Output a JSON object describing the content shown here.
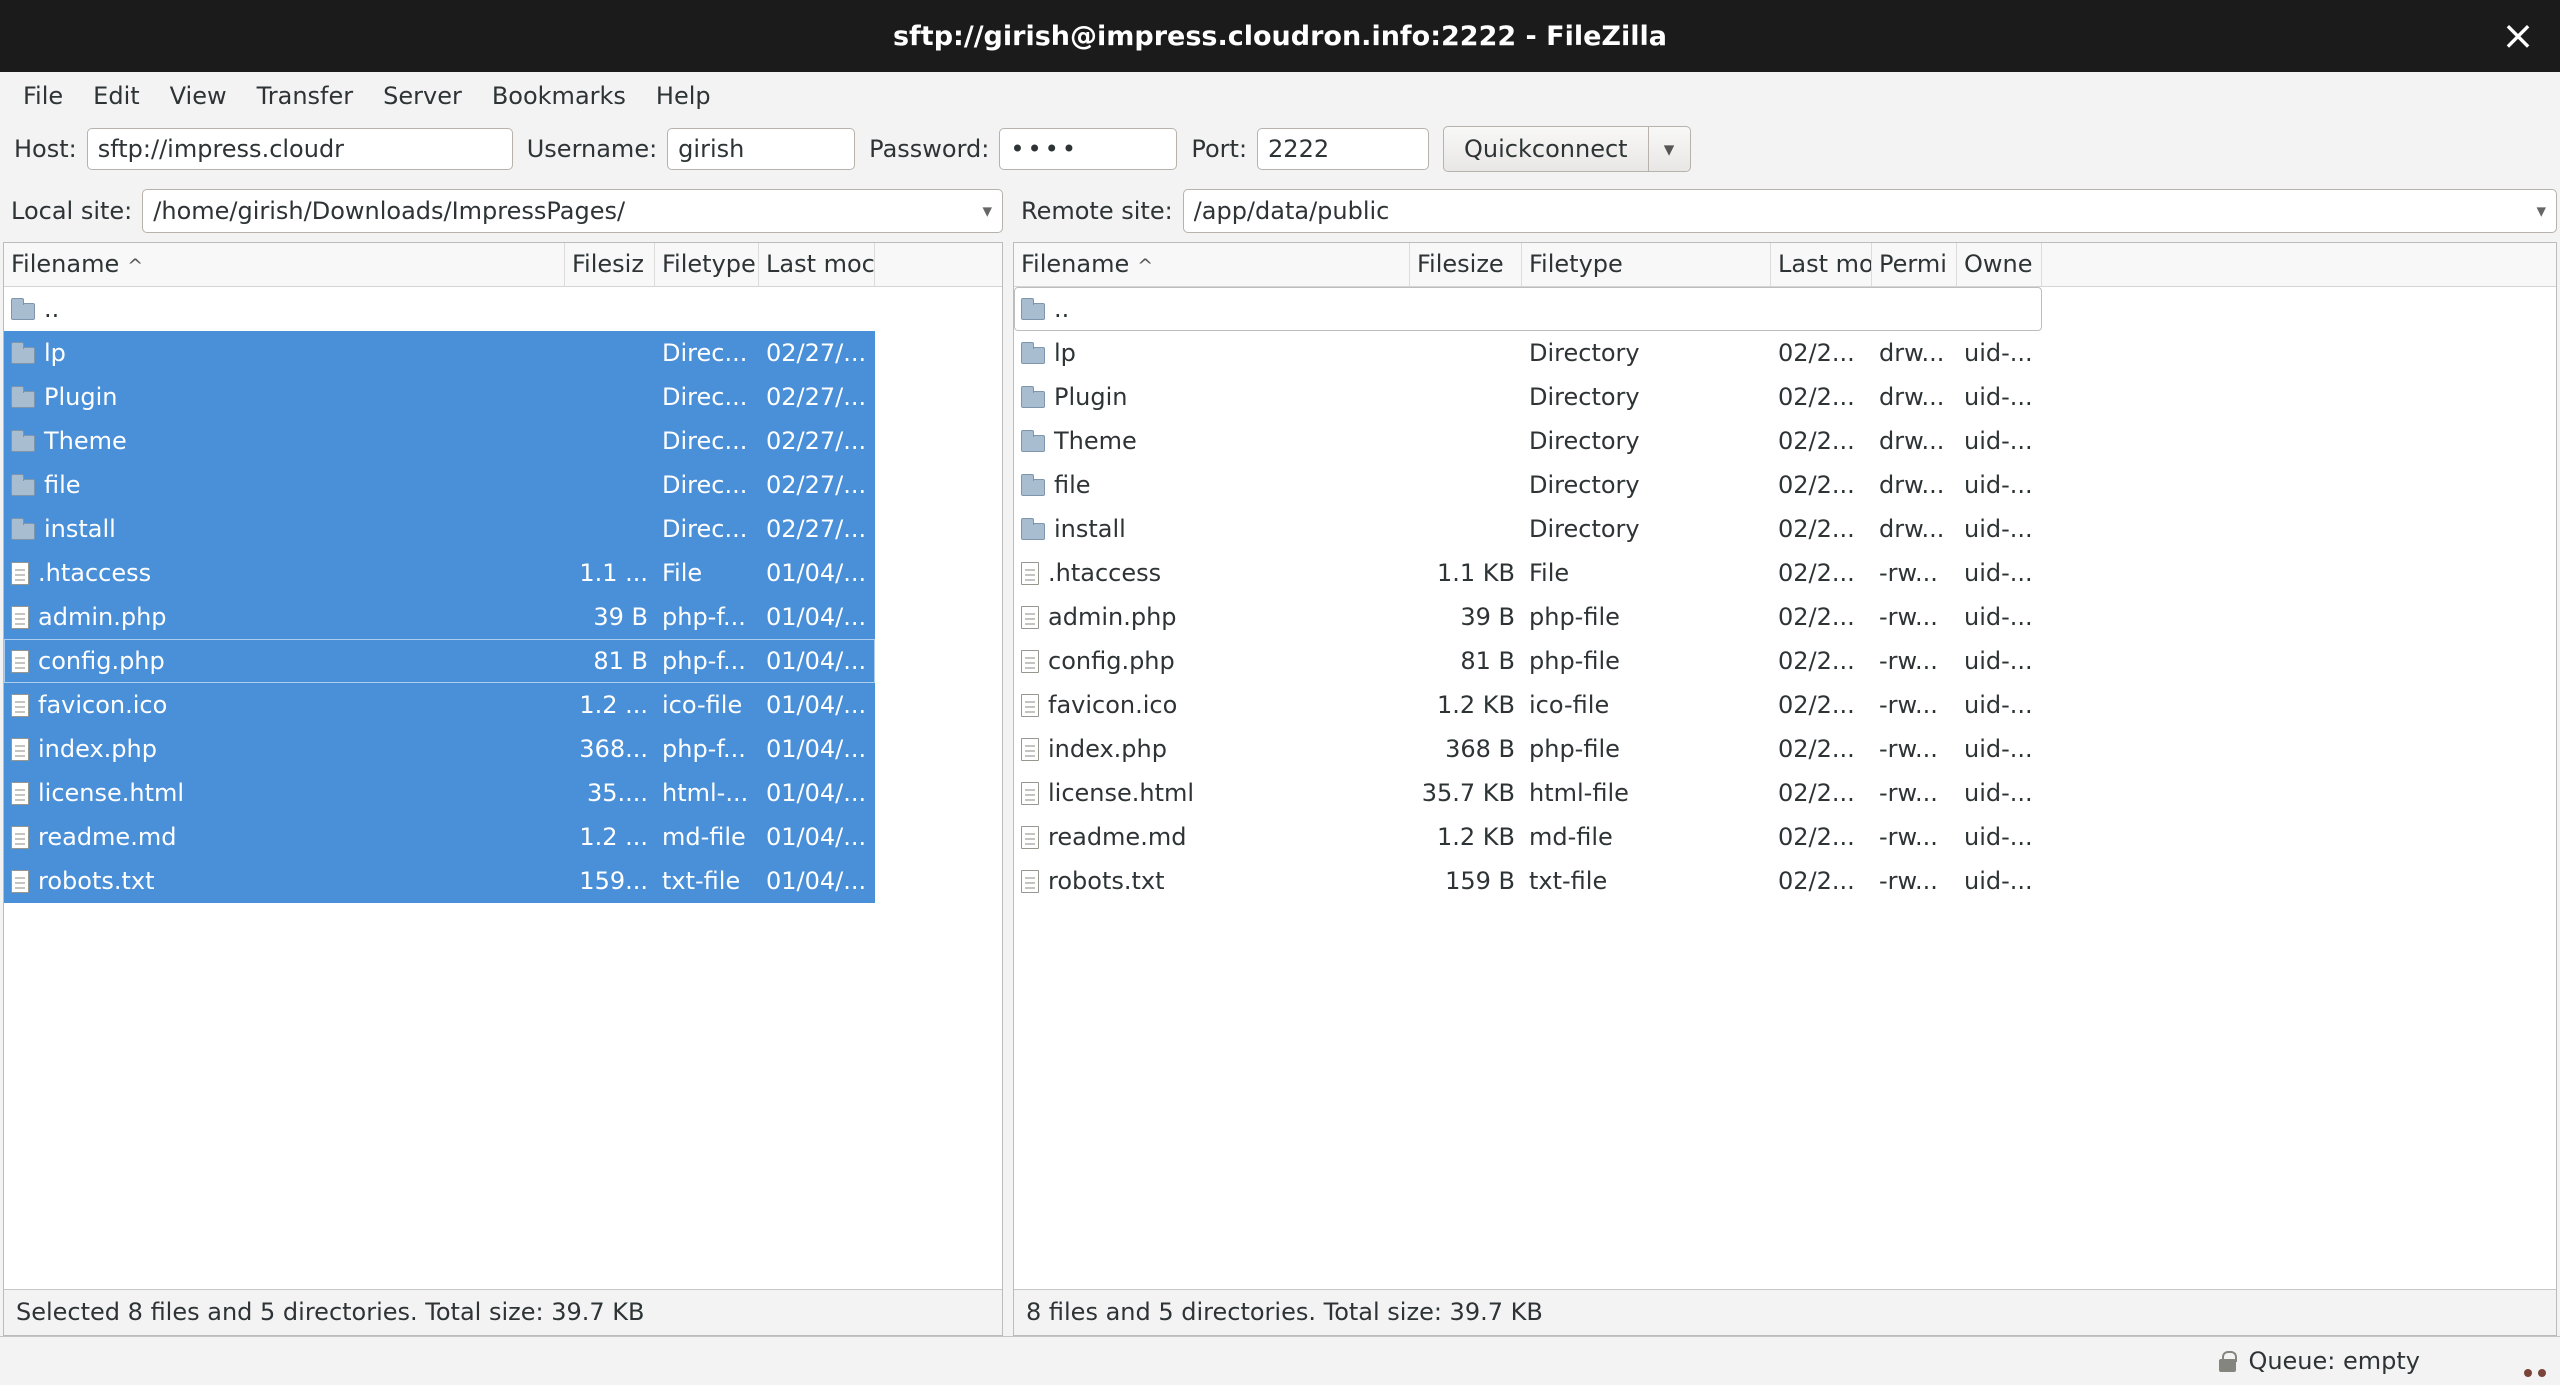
{
  "window": {
    "title": "sftp://girish@impress.cloudron.info:2222 - FileZilla"
  },
  "glyphs": {
    "close": "×",
    "caret": "▾",
    "sort": "^"
  },
  "menu": {
    "items": [
      "File",
      "Edit",
      "View",
      "Transfer",
      "Server",
      "Bookmarks",
      "Help"
    ]
  },
  "quickconnect": {
    "host_label": "Host:",
    "host_value": "sftp://impress.cloudr",
    "username_label": "Username:",
    "username_value": "girish",
    "password_label": "Password:",
    "password_value": "••••",
    "port_label": "Port:",
    "port_value": "2222",
    "button_label": "Quickconnect"
  },
  "local": {
    "site_label": "Local site:",
    "site_value": "/home/girish/Downloads/ImpressPages/",
    "columns": [
      "Filename",
      "Filesiz",
      "Filetype",
      "Last moc"
    ],
    "status": "Selected 8 files and 5 directories. Total size: 39.7 KB",
    "rows": [
      {
        "kind": "parent",
        "name": "..",
        "size": "",
        "type": "",
        "date": "",
        "selected": false
      },
      {
        "kind": "dir",
        "name": "lp",
        "size": "",
        "type": "Direc...",
        "date": "02/27/...",
        "selected": true
      },
      {
        "kind": "dir",
        "name": "Plugin",
        "size": "",
        "type": "Direc...",
        "date": "02/27/...",
        "selected": true
      },
      {
        "kind": "dir",
        "name": "Theme",
        "size": "",
        "type": "Direc...",
        "date": "02/27/...",
        "selected": true
      },
      {
        "kind": "dir",
        "name": "file",
        "size": "",
        "type": "Direc...",
        "date": "02/27/...",
        "selected": true
      },
      {
        "kind": "dir",
        "name": "install",
        "size": "",
        "type": "Direc...",
        "date": "02/27/...",
        "selected": true
      },
      {
        "kind": "file",
        "name": ".htaccess",
        "size": "1.1 ...",
        "type": "File",
        "date": "01/04/...",
        "selected": true
      },
      {
        "kind": "file",
        "name": "admin.php",
        "size": "39 B",
        "type": "php-f...",
        "date": "01/04/...",
        "selected": true
      },
      {
        "kind": "file",
        "name": "config.php",
        "size": "81 B",
        "type": "php-f...",
        "date": "01/04/...",
        "selected": true,
        "focused": true
      },
      {
        "kind": "file",
        "name": "favicon.ico",
        "size": "1.2 ...",
        "type": "ico-file",
        "date": "01/04/...",
        "selected": true
      },
      {
        "kind": "file",
        "name": "index.php",
        "size": "368...",
        "type": "php-f...",
        "date": "01/04/...",
        "selected": true
      },
      {
        "kind": "file",
        "name": "license.html",
        "size": "35....",
        "type": "html-...",
        "date": "01/04/...",
        "selected": true
      },
      {
        "kind": "file",
        "name": "readme.md",
        "size": "1.2 ...",
        "type": "md-file",
        "date": "01/04/...",
        "selected": true
      },
      {
        "kind": "file",
        "name": "robots.txt",
        "size": "159...",
        "type": "txt-file",
        "date": "01/04/...",
        "selected": true
      }
    ]
  },
  "remote": {
    "site_label": "Remote site:",
    "site_value": "/app/data/public",
    "columns": [
      "Filename",
      "Filesize",
      "Filetype",
      "Last mo",
      "Permi",
      "Owne"
    ],
    "status": "8 files and 5 directories. Total size: 39.7 KB",
    "rows": [
      {
        "kind": "parent",
        "name": "..",
        "size": "",
        "type": "",
        "date": "",
        "perms": "",
        "owner": "",
        "focused": true
      },
      {
        "kind": "dir",
        "name": "lp",
        "size": "",
        "type": "Directory",
        "date": "02/2...",
        "perms": "drw...",
        "owner": "uid-..."
      },
      {
        "kind": "dir",
        "name": "Plugin",
        "size": "",
        "type": "Directory",
        "date": "02/2...",
        "perms": "drw...",
        "owner": "uid-..."
      },
      {
        "kind": "dir",
        "name": "Theme",
        "size": "",
        "type": "Directory",
        "date": "02/2...",
        "perms": "drw...",
        "owner": "uid-..."
      },
      {
        "kind": "dir",
        "name": "file",
        "size": "",
        "type": "Directory",
        "date": "02/2...",
        "perms": "drw...",
        "owner": "uid-..."
      },
      {
        "kind": "dir",
        "name": "install",
        "size": "",
        "type": "Directory",
        "date": "02/2...",
        "perms": "drw...",
        "owner": "uid-..."
      },
      {
        "kind": "file",
        "name": ".htaccess",
        "size": "1.1 KB",
        "type": "File",
        "date": "02/2...",
        "perms": "-rw...",
        "owner": "uid-..."
      },
      {
        "kind": "file",
        "name": "admin.php",
        "size": "39 B",
        "type": "php-file",
        "date": "02/2...",
        "perms": "-rw...",
        "owner": "uid-..."
      },
      {
        "kind": "file",
        "name": "config.php",
        "size": "81 B",
        "type": "php-file",
        "date": "02/2...",
        "perms": "-rw...",
        "owner": "uid-..."
      },
      {
        "kind": "file",
        "name": "favicon.ico",
        "size": "1.2 KB",
        "type": "ico-file",
        "date": "02/2...",
        "perms": "-rw...",
        "owner": "uid-..."
      },
      {
        "kind": "file",
        "name": "index.php",
        "size": "368 B",
        "type": "php-file",
        "date": "02/2...",
        "perms": "-rw...",
        "owner": "uid-..."
      },
      {
        "kind": "file",
        "name": "license.html",
        "size": "35.7 KB",
        "type": "html-file",
        "date": "02/2...",
        "perms": "-rw...",
        "owner": "uid-..."
      },
      {
        "kind": "file",
        "name": "readme.md",
        "size": "1.2 KB",
        "type": "md-file",
        "date": "02/2...",
        "perms": "-rw...",
        "owner": "uid-..."
      },
      {
        "kind": "file",
        "name": "robots.txt",
        "size": "159 B",
        "type": "txt-file",
        "date": "02/2...",
        "perms": "-rw...",
        "owner": "uid-..."
      }
    ]
  },
  "statusbar": {
    "queue_label": "Queue: empty"
  }
}
